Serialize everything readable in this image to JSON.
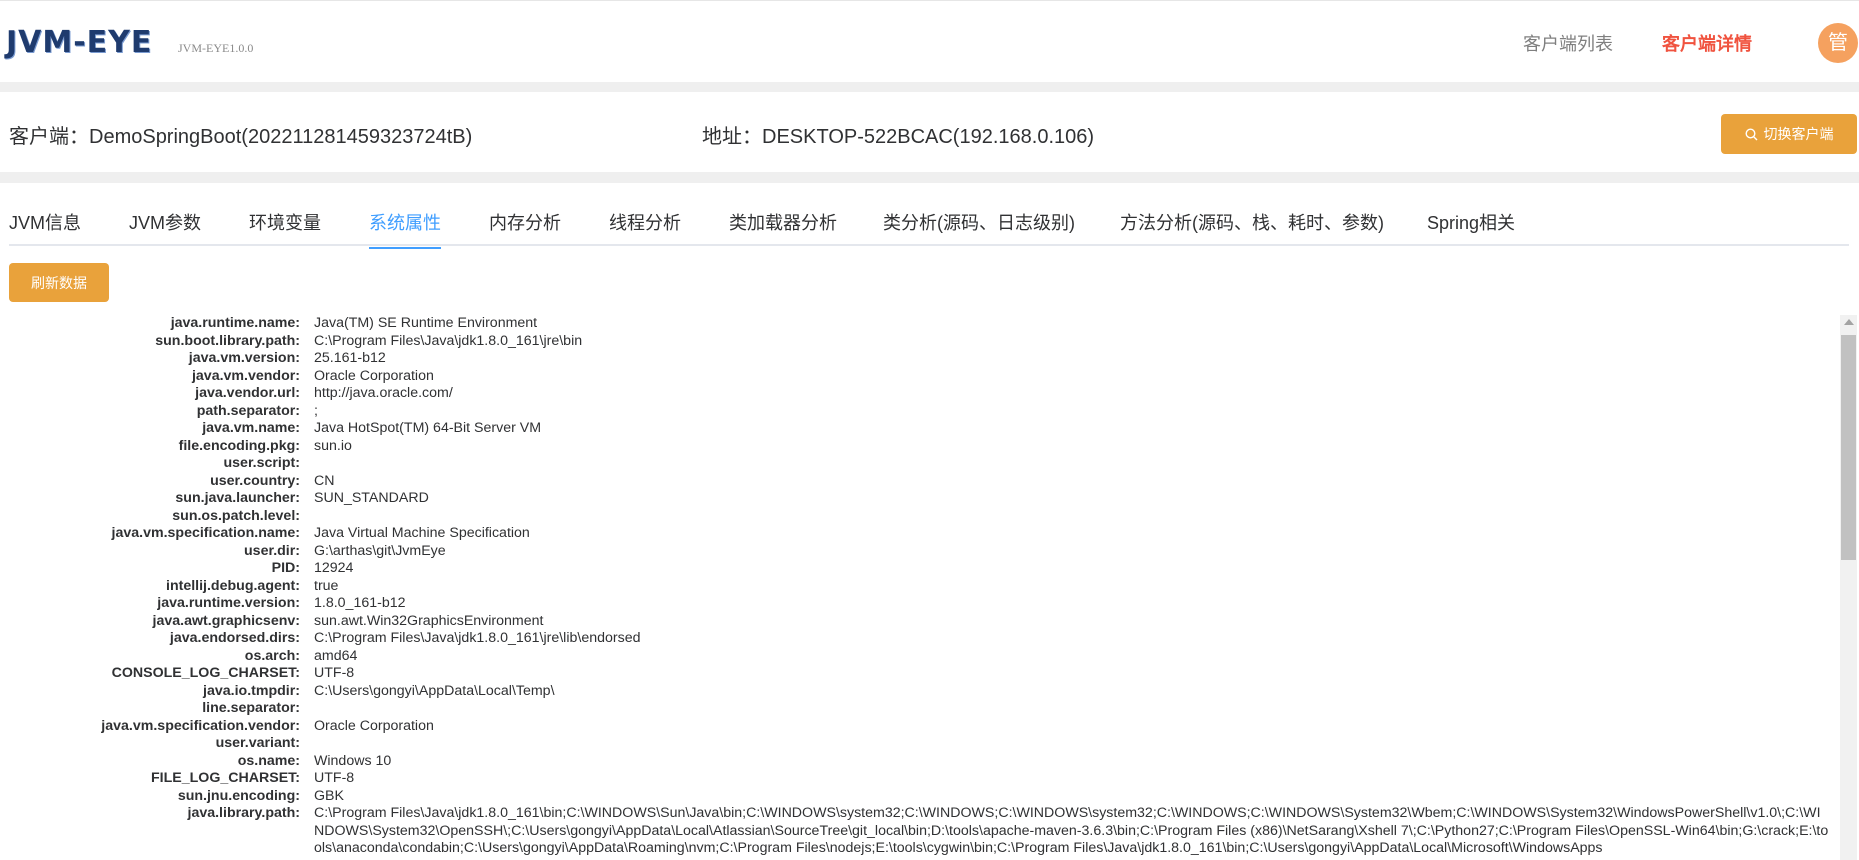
{
  "header": {
    "logo": "JVM-EYE",
    "version": "JVM-EYE1.0.0",
    "nav": {
      "client_list": "客户端列表",
      "client_detail": "客户端详情"
    },
    "avatar_text": "管"
  },
  "client": {
    "name": "客户端：DemoSpringBoot(202211281459323724tB)",
    "address": "地址：DESKTOP-522BCAC(192.168.0.106)",
    "switch_label": "切换客户端"
  },
  "tabs": [
    {
      "label": "JVM信息"
    },
    {
      "label": "JVM参数"
    },
    {
      "label": "环境变量"
    },
    {
      "label": "系统属性"
    },
    {
      "label": "内存分析"
    },
    {
      "label": "线程分析"
    },
    {
      "label": "类加载器分析"
    },
    {
      "label": "类分析(源码、日志级别)"
    },
    {
      "label": "方法分析(源码、栈、耗时、参数)"
    },
    {
      "label": "Spring相关"
    }
  ],
  "active_tab": "系统属性",
  "refresh_label": "刷新数据",
  "properties": [
    {
      "key": "java.runtime.name:",
      "value": "Java(TM) SE Runtime Environment"
    },
    {
      "key": "sun.boot.library.path:",
      "value": "C:\\Program Files\\Java\\jdk1.8.0_161\\jre\\bin"
    },
    {
      "key": "java.vm.version:",
      "value": "25.161-b12"
    },
    {
      "key": "java.vm.vendor:",
      "value": "Oracle Corporation"
    },
    {
      "key": "java.vendor.url:",
      "value": "http://java.oracle.com/"
    },
    {
      "key": "path.separator:",
      "value": ";"
    },
    {
      "key": "java.vm.name:",
      "value": "Java HotSpot(TM) 64-Bit Server VM"
    },
    {
      "key": "file.encoding.pkg:",
      "value": "sun.io"
    },
    {
      "key": "user.script:",
      "value": ""
    },
    {
      "key": "user.country:",
      "value": "CN"
    },
    {
      "key": "sun.java.launcher:",
      "value": "SUN_STANDARD"
    },
    {
      "key": "sun.os.patch.level:",
      "value": ""
    },
    {
      "key": "java.vm.specification.name:",
      "value": "Java Virtual Machine Specification"
    },
    {
      "key": "user.dir:",
      "value": "G:\\arthas\\git\\JvmEye"
    },
    {
      "key": "PID:",
      "value": "12924"
    },
    {
      "key": "intellij.debug.agent:",
      "value": "true"
    },
    {
      "key": "java.runtime.version:",
      "value": "1.8.0_161-b12"
    },
    {
      "key": "java.awt.graphicsenv:",
      "value": "sun.awt.Win32GraphicsEnvironment"
    },
    {
      "key": "java.endorsed.dirs:",
      "value": "C:\\Program Files\\Java\\jdk1.8.0_161\\jre\\lib\\endorsed"
    },
    {
      "key": "os.arch:",
      "value": "amd64"
    },
    {
      "key": "CONSOLE_LOG_CHARSET:",
      "value": "UTF-8"
    },
    {
      "key": "java.io.tmpdir:",
      "value": "C:\\Users\\gongyi\\AppData\\Local\\Temp\\"
    },
    {
      "key": "line.separator:",
      "value": ""
    },
    {
      "key": "java.vm.specification.vendor:",
      "value": "Oracle Corporation"
    },
    {
      "key": "user.variant:",
      "value": ""
    },
    {
      "key": "os.name:",
      "value": "Windows 10"
    },
    {
      "key": "FILE_LOG_CHARSET:",
      "value": "UTF-8"
    },
    {
      "key": "sun.jnu.encoding:",
      "value": "GBK"
    },
    {
      "key": "java.library.path:",
      "value": "C:\\Program Files\\Java\\jdk1.8.0_161\\bin;C:\\WINDOWS\\Sun\\Java\\bin;C:\\WINDOWS\\system32;C:\\WINDOWS;C:\\WINDOWS\\system32;C:\\WINDOWS;C:\\WINDOWS\\System32\\Wbem;C:\\WINDOWS\\System32\\WindowsPowerShell\\v1.0\\;C:\\WINDOWS\\System32\\OpenSSH\\;C:\\Users\\gongyi\\AppData\\Local\\Atlassian\\SourceTree\\git_local\\bin;D:\\tools\\apache-maven-3.6.3\\bin;C:\\Program Files (x86)\\NetSarang\\Xshell 7\\;C:\\Python27;C:\\Program Files\\OpenSSL-Win64\\bin;G:\\crack;E:\\tools\\anaconda\\condabin;C:\\Users\\gongyi\\AppData\\Roaming\\nvm;C:\\Program Files\\nodejs;E:\\tools\\cygwin\\bin;C:\\Program Files\\Java\\jdk1.8.0_161\\bin;C:\\Users\\gongyi\\AppData\\Local\\Microsoft\\WindowsApps"
    }
  ],
  "colors": {
    "accent_blue": "#409eff",
    "button_orange": "#e9a23b",
    "nav_active": "#f0533f",
    "avatar": "#f5a15f"
  }
}
